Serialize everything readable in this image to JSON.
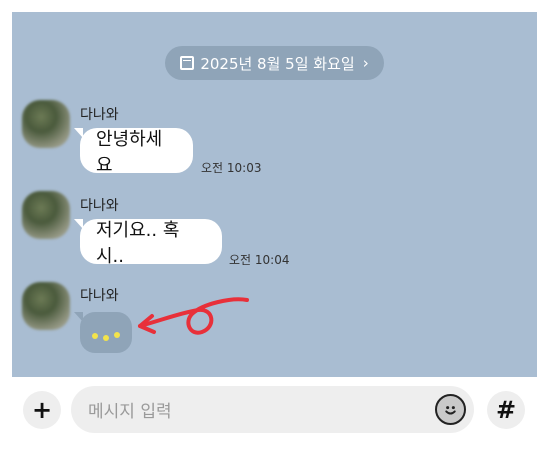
{
  "date_divider": {
    "label": "2025년 8월 5일 화요일",
    "chevron": "›"
  },
  "messages": [
    {
      "sender": "다나와",
      "text": "안녕하세요",
      "time": "오전 10:03"
    },
    {
      "sender": "다나와",
      "text": "저기요.. 혹시..",
      "time": "오전 10:04"
    },
    {
      "sender": "다나와",
      "text": "",
      "typing": true
    }
  ],
  "input": {
    "placeholder": "메시지 입력",
    "plus_label": "+",
    "hash_label": "#"
  },
  "colors": {
    "chat_bg": "#a9bdd2",
    "typing_dots": "#f3e34a",
    "annotation": "#e8303a"
  },
  "icons": [
    "calendar-icon",
    "chevron-right-icon",
    "plus-icon",
    "emoji-icon",
    "hashtag-icon"
  ]
}
